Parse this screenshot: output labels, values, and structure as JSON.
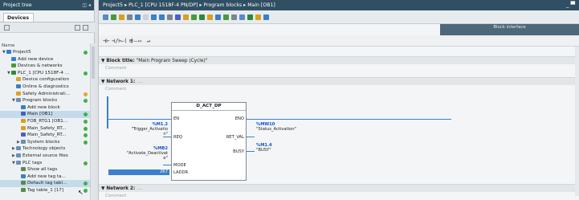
{
  "project_tree": {
    "header": "Project tree",
    "tab": "Devices",
    "column_name": "Name",
    "items": [
      {
        "label": "Project5",
        "level": 0,
        "expand": "▼",
        "status": "ok",
        "icon_color": "#2f7fd0"
      },
      {
        "label": "Add new device",
        "level": 1,
        "expand": "",
        "status": "",
        "icon_color": "#3b7fc4"
      },
      {
        "label": "Devices & networks",
        "level": 1,
        "expand": "",
        "status": "",
        "icon_color": "#4a9a3c"
      },
      {
        "label": "PLC_1 [CPU 1518F-4 ...",
        "level": 1,
        "expand": "▼",
        "status": "ok",
        "icon_color": "#2a8a3a"
      },
      {
        "label": "Device configuration",
        "level": 2,
        "expand": "",
        "status": "",
        "icon_color": "#d6a62b"
      },
      {
        "label": "Online & diagnostics",
        "level": 2,
        "expand": "",
        "status": "",
        "icon_color": "#3b7fc4"
      },
      {
        "label": "Safety Administrati...",
        "level": 2,
        "expand": "",
        "status": "warn",
        "icon_color": "#e0a020"
      },
      {
        "label": "Program blocks",
        "level": 2,
        "expand": "▼",
        "status": "ok",
        "icon_color": "#6b8fb5"
      },
      {
        "label": "Add new block",
        "level": 3,
        "expand": "",
        "status": "",
        "icon_color": "#3b7fc4"
      },
      {
        "label": "Main [OB1]",
        "level": 3,
        "expand": "",
        "status": "ok",
        "icon_color": "#4a5fc2",
        "selected": true
      },
      {
        "label": "FOB_RTG1 [OB1...",
        "level": 3,
        "expand": "",
        "status": "ok",
        "icon_color": "#d8a020"
      },
      {
        "label": "Main_Safety_RT...",
        "level": 3,
        "expand": "",
        "status": "ok",
        "icon_color": "#d8a020"
      },
      {
        "label": "Main_Safety_RT...",
        "level": 3,
        "expand": "",
        "status": "ok",
        "icon_color": "#4a5fc2"
      },
      {
        "label": "System blocks",
        "level": 3,
        "expand": "▶",
        "status": "ok",
        "icon_color": "#6b8fb5"
      },
      {
        "label": "Technology objects",
        "level": 2,
        "expand": "▶",
        "status": "",
        "icon_color": "#6b8fb5"
      },
      {
        "label": "External source files",
        "level": 2,
        "expand": "▶",
        "status": "",
        "icon_color": "#6b8fb5"
      },
      {
        "label": "PLC tags",
        "level": 2,
        "expand": "▼",
        "status": "ok",
        "icon_color": "#6b8fb5"
      },
      {
        "label": "Show all tags",
        "level": 3,
        "expand": "",
        "status": "",
        "icon_color": "#5a8a4a"
      },
      {
        "label": "Add new tag ta...",
        "level": 3,
        "expand": "",
        "status": "",
        "icon_color": "#3b7fc4"
      },
      {
        "label": "Default tag tabl...",
        "level": 3,
        "expand": "",
        "status": "ok",
        "icon_color": "#5a8a4a",
        "selected": true
      },
      {
        "label": "Tag table_1 [17]",
        "level": 3,
        "expand": "",
        "status": "ok",
        "icon_color": "#5a8a4a"
      }
    ]
  },
  "editor": {
    "breadcrumb": "Project5 ▸ PLC_1 [CPU 1518F-4 PN/DP] ▸ Program blocks ▸ Main [OB1]",
    "window_controls": "_ ▀",
    "interface_bar": "Block interface",
    "lad_toolbar": [
      "⊣⊢",
      "⊣/⊢",
      "–( )–",
      "⊞",
      "↦",
      "↵"
    ],
    "block_title_label": "Block title:",
    "block_title_value": "\"Main Program Sweep (Cycle)\"",
    "block_comment": "Comment",
    "network1_label": "Network 1:",
    "network1_dots": "....",
    "network1_comment": "Comment",
    "network2_label": "Network 2:",
    "network2_dots": "....",
    "network2_comment": "Comment"
  },
  "function_block": {
    "title": "D_ACT_DP",
    "pin_en": "EN",
    "pin_eno": "ENO",
    "pin_req": "REQ",
    "pin_mode": "MODE",
    "pin_laddr": "LADDR",
    "pin_retval": "RET_VAL",
    "pin_busy": "BUSY",
    "req_tag": "%M1.2",
    "req_name": "\"Trigger_Activation\"",
    "mode_tag": "%MB2",
    "mode_name": "\"Activate_Deactivate\"",
    "laddr_value": "267",
    "retval_tag": "%MW10",
    "retval_name": "\"Status_Activation\"",
    "busy_tag": "%M1.4",
    "busy_name": "\"BUSY\""
  }
}
